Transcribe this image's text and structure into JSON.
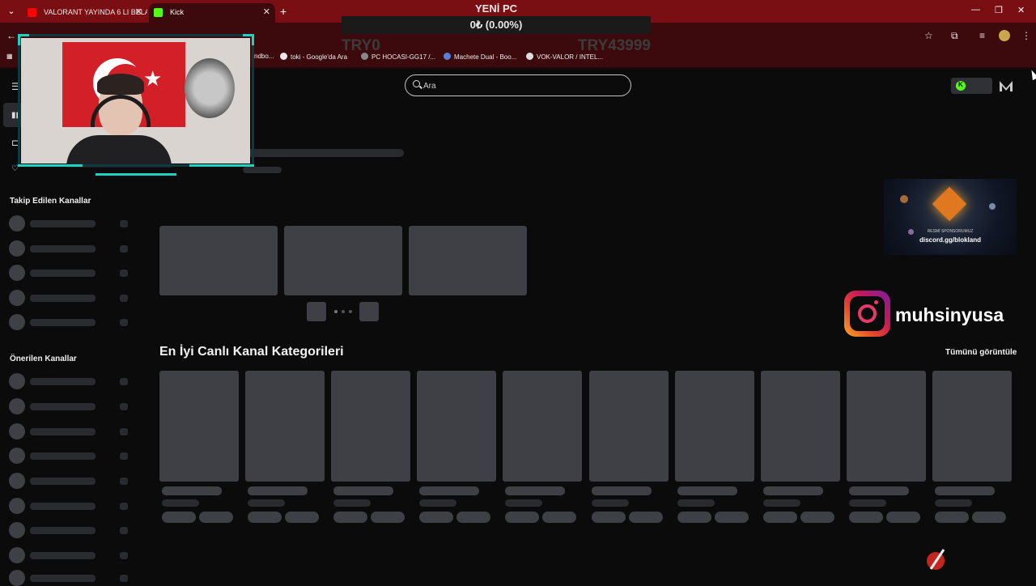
{
  "browser": {
    "tabs": [
      {
        "title": "VALORANT YAYINDA 6 LI BELA",
        "favicon": "youtube-icon",
        "active": false
      },
      {
        "title": "Kick",
        "favicon": "kick-icon",
        "active": true
      }
    ],
    "new_tab_label": "+",
    "bookmarks": [
      {
        "label": "ndbo..."
      },
      {
        "label": "toki - Google'da Ara"
      },
      {
        "label": "PC HOCASI-GG17 /..."
      },
      {
        "label": "Machete Dual - Boo..."
      },
      {
        "label": "VOK-VALOR / INTEL..."
      }
    ]
  },
  "overlay": {
    "title": "YENİ PC",
    "progress_text": "0₺ (0.00%)",
    "progress_fraction": 0,
    "range_low": "TRY0",
    "range_high": "TRY43999"
  },
  "search": {
    "placeholder": "Ara"
  },
  "sidebar": {
    "followed_heading": "Takip Edilen Kanallar",
    "recommended_heading": "Önerilen Kanallar"
  },
  "main": {
    "categories_title": "En İyi Canlı Kanal Kategorileri",
    "view_all_label": "Tümünü görüntüle"
  },
  "sponsor": {
    "small_text": "RESMİ SPONSORUMUZ",
    "link_text": "discord.gg/blokland"
  },
  "social": {
    "handle": "muhsinyusa",
    "icon": "instagram-icon"
  },
  "colors": {
    "kick_green": "#53fc18",
    "tab_bar": "#7a0f13",
    "toolbar": "#3c0a0c",
    "page_bg": "#0b0b0c",
    "skeleton": "#3e4045"
  }
}
